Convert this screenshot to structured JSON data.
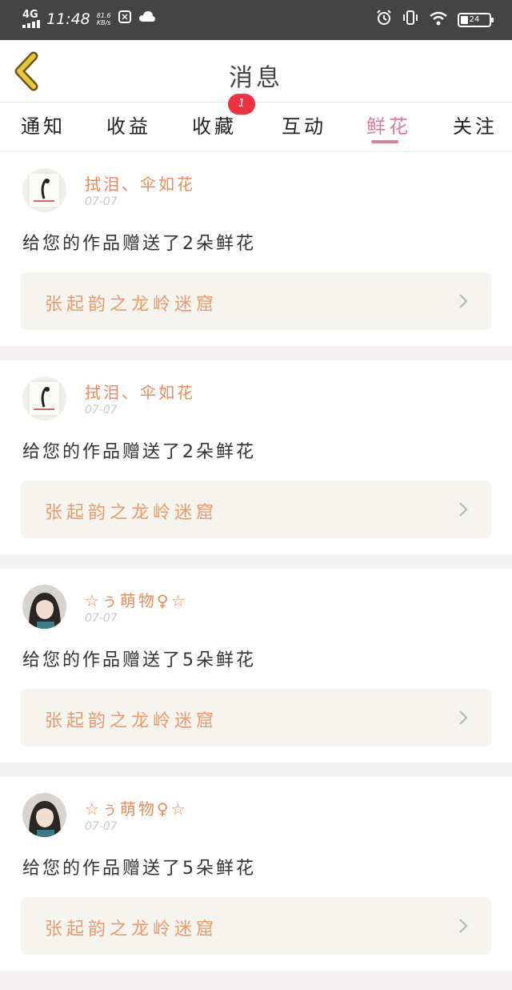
{
  "status_bar": {
    "network": "4G",
    "time": "11:48",
    "speed_value": "81.6",
    "speed_unit": "KB/s",
    "battery": "24",
    "icons": [
      "signal-icon",
      "clock-app-icon",
      "cloud-icon",
      "alarm-icon",
      "vibrate-icon",
      "wifi-icon",
      "battery-icon"
    ]
  },
  "header": {
    "title": "消息",
    "back_icon": "chevron-left-icon",
    "accent_color": "#e07aa3"
  },
  "tabs": [
    {
      "label": "通知"
    },
    {
      "label": "收益"
    },
    {
      "label": "收藏",
      "badge": "1"
    },
    {
      "label": "互动"
    },
    {
      "label": "鲜花",
      "active": true
    },
    {
      "label": "关注"
    }
  ],
  "messages": [
    {
      "name": "拭泪、伞如花",
      "date": "07-07",
      "text": "给您的作品赠送了2朵鲜花",
      "work_title": "张起韵之龙岭迷窟",
      "avatar": "ink-portrait"
    },
    {
      "name": "拭泪、伞如花",
      "date": "07-07",
      "text": "给您的作品赠送了2朵鲜花",
      "work_title": "张起韵之龙岭迷窟",
      "avatar": "ink-portrait"
    },
    {
      "name": "☆ぅ萌物♀☆",
      "date": "07-07",
      "text": "给您的作品赠送了5朵鲜花",
      "work_title": "张起韵之龙岭迷窟",
      "avatar": "girl-portrait"
    },
    {
      "name": "☆ぅ萌物♀☆",
      "date": "07-07",
      "text": "给您的作品赠送了5朵鲜花",
      "work_title": "张起韵之龙岭迷窟",
      "avatar": "girl-portrait"
    }
  ]
}
